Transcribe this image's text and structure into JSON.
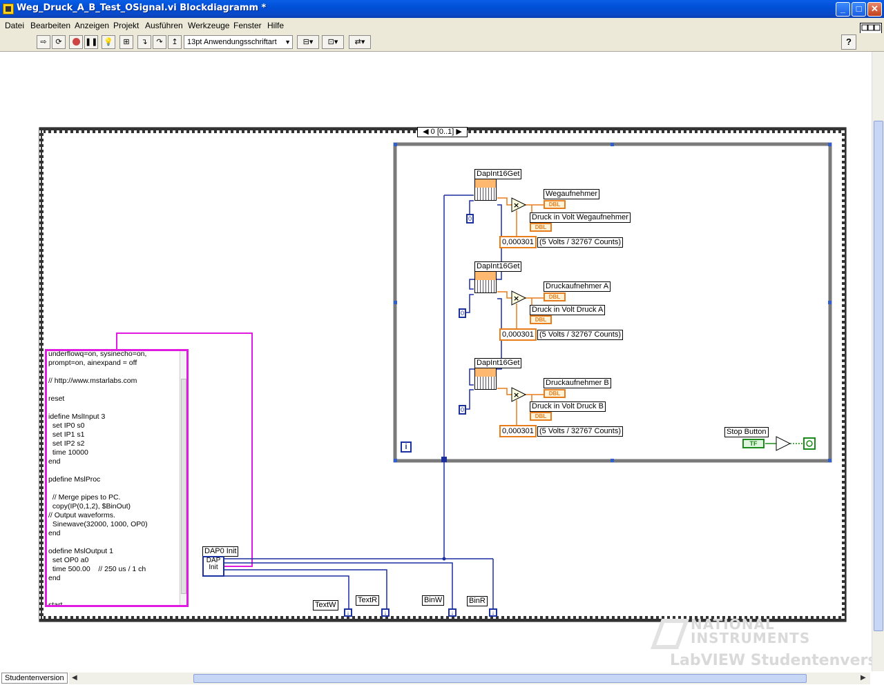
{
  "window": {
    "title": "Weg_Druck_A_B_Test_OSignal.vi Blockdiagramm *",
    "buttons": {
      "minimize": "_",
      "maximize": "□",
      "close": "✕"
    }
  },
  "menu": [
    "Datei",
    "Bearbeiten",
    "Anzeigen",
    "Projekt",
    "Ausführen",
    "Werkzeuge",
    "Fenster",
    "Hilfe"
  ],
  "toolbar": {
    "font_select": "13pt Anwendungsschriftart",
    "help_label": "?",
    "vi_icon_number": "3"
  },
  "diagram": {
    "sequence_selector": "0 [0..1]",
    "loop_iteration": "i",
    "dap_init_label": "DAP0 Init",
    "dap_init_text": "DAP Init",
    "stop_button_label": "Stop Button",
    "tf_label": "TF",
    "channels": [
      {
        "vi": "DapInt16Get",
        "index": "0",
        "indicator": "Wegaufnehmer",
        "volt_label": "Druck in Volt Wegaufnehmer",
        "factor": "0,000301",
        "factor_note": "(5 Volts / 32767 Counts)"
      },
      {
        "vi": "DapInt16Get",
        "index": "0",
        "indicator": "Druckaufnehmer A",
        "volt_label": "Druck in Volt Druck A",
        "factor": "0,000301",
        "factor_note": "(5 Volts / 32767 Counts)"
      },
      {
        "vi": "DapInt16Get",
        "index": "0",
        "indicator": "Druckaufnehmer B",
        "volt_label": "Druck in Volt Druck B",
        "factor": "0,000301",
        "factor_note": "(5 Volts / 32767 Counts)"
      }
    ],
    "dbl_tag": "DBL",
    "bottom_labels": [
      "TextW",
      "TextR",
      "BinW",
      "BinR"
    ],
    "code_lines": "underflowq=on, sysinecho=on,\nprompt=on, ainexpand = off\n\n// http://www.mstarlabs.com\n\nreset\n\nidefine MslInput 3\n  set IP0 s0\n  set IP1 s1\n  set IP2 s2\n  time 10000\nend\n\npdefine MslProc\n\n  // Merge pipes to PC.\n  copy(IP(0,1,2), $BinOut)\n// Output waveforms.\n  Sinewave(32000, 1000, OP0)\nend\n\nodefine MslOutput 1\n  set OP0 a0\n  time 500.00    // 250 us / 1 ch\nend\n\n\nstart"
  },
  "status": {
    "left_label": "Studentenversion"
  },
  "watermark": {
    "line1": "NATIONAL",
    "line2": "INSTRUMENTS",
    "line3": "LabVIEW Studentenversion"
  }
}
